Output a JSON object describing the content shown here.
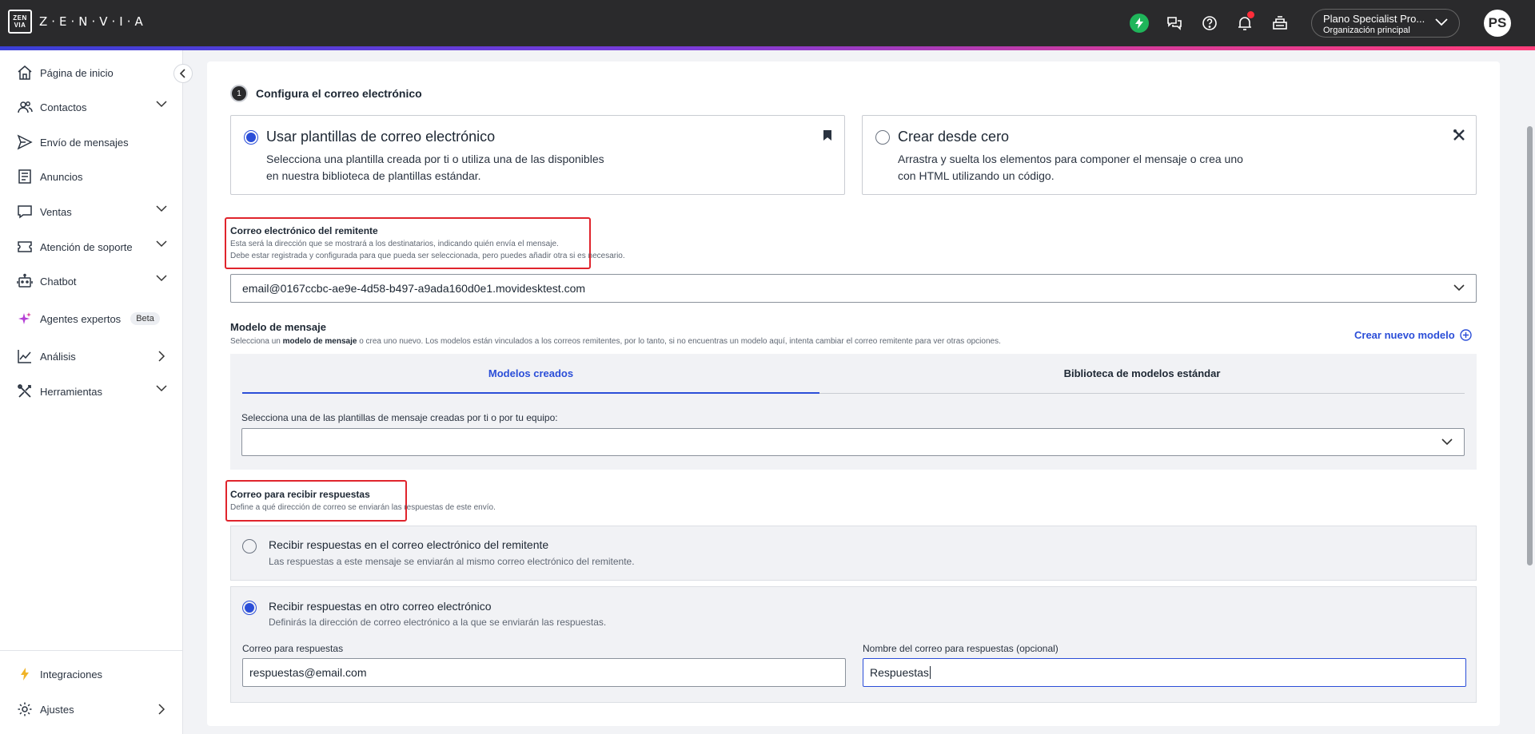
{
  "app": {
    "logo_box_line1": "ZEN",
    "logo_box_line2": "VIA",
    "logo_text": "Z·E·N·V·I·A"
  },
  "header": {
    "org_name": "Plano Specialist Pro...",
    "org_sub": "Organización principal",
    "avatar_initials": "PS",
    "icons": [
      "bolt-icon",
      "chat-icon",
      "help-icon",
      "bell-icon",
      "inbox-icon"
    ]
  },
  "sidebar": {
    "items": [
      {
        "label": "Página de inicio",
        "icon": "home-icon"
      },
      {
        "label": "Contactos",
        "icon": "contacts-icon"
      },
      {
        "label": "Envío de mensajes",
        "icon": "send-icon"
      },
      {
        "label": "Anuncios",
        "icon": "announcements-icon"
      },
      {
        "label": "Ventas",
        "icon": "sales-icon"
      },
      {
        "label": "Atención de soporte",
        "icon": "support-icon"
      },
      {
        "label": "Chatbot",
        "icon": "chatbot-icon"
      },
      {
        "label": "Agentes expertos",
        "icon": "sparkle-icon",
        "badge": "Beta"
      },
      {
        "label": "Análisis",
        "icon": "analytics-icon"
      },
      {
        "label": "Herramientas",
        "icon": "tools-icon"
      }
    ],
    "bottom_items": [
      {
        "label": "Integraciones",
        "icon": "integrations-icon"
      },
      {
        "label": "Ajustes",
        "icon": "settings-icon"
      }
    ]
  },
  "main": {
    "step_number": "1",
    "step_title": "Configura el correo electrónico",
    "option_templates": {
      "title": "Usar plantillas de correo electrónico",
      "desc_line1": "Selecciona una plantilla creada por ti o utiliza una de las disponibles",
      "desc_line2": "en nuestra biblioteca de plantillas estándar."
    },
    "option_scratch": {
      "title": "Crear desde cero",
      "desc_line1": "Arrastra y suelta los elementos para componer el mensaje o crea uno",
      "desc_line2": "con HTML utilizando un código."
    },
    "sender": {
      "title": "Correo electrónico del remitente",
      "desc_line1": "Esta será la dirección que se mostrará a los destinatarios, indicando quién envía el mensaje.",
      "desc_line2": "Debe estar registrada y configurada para que pueda ser seleccionada, pero puedes añadir otra si es necesario.",
      "value": "email@0167ccbc-ae9e-4d58-b497-a9ada160d0e1.movidesktest.com"
    },
    "model": {
      "title": "Modelo de mensaje",
      "desc_pre": "Selecciona un ",
      "desc_bold": "modelo de mensaje",
      "desc_post": " o crea uno nuevo. Los modelos están vinculados a los correos remitentes, por lo tanto, si no encuentras un modelo aquí, intenta cambiar el correo remitente para ver otras opciones.",
      "create_label": "Crear nuevo modelo",
      "tab_created": "Modelos creados",
      "tab_library": "Biblioteca de modelos estándar",
      "select_label": "Selecciona una de las plantillas de mensaje creadas por ti o por tu equipo:",
      "select_value": ""
    },
    "reply": {
      "title": "Correo para recibir respuestas",
      "desc": "Define a qué dirección de correo se enviarán las respuestas de este envío.",
      "option1_title": "Recibir respuestas en el correo electrónico del remitente",
      "option1_desc": "Las respuestas a este mensaje se enviarán al mismo correo electrónico del remitente.",
      "option2_title": "Recibir respuestas en otro correo electrónico",
      "option2_desc": "Definirás la dirección de correo electrónico a la que se enviarán las respuestas.",
      "email_label": "Correo para respuestas",
      "email_value": "respuestas@email.com",
      "name_label": "Nombre del correo para respuestas (opcional)",
      "name_value": "Respuestas"
    }
  },
  "colors": {
    "accent": "#2b4ed8",
    "topbar": "#2a2a2c",
    "highlight_red": "#e0242c",
    "success_green": "#1fb55a"
  }
}
